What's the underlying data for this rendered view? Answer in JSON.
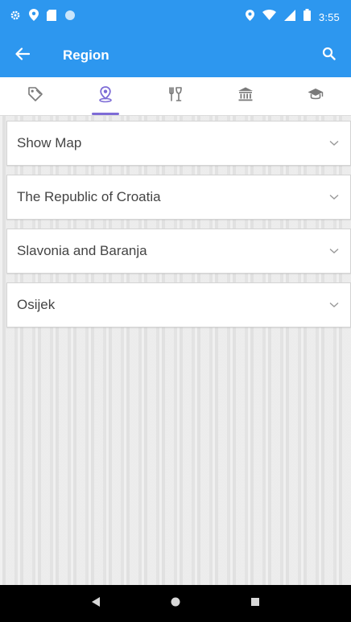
{
  "status_bar": {
    "time": "3:55"
  },
  "app_bar": {
    "title": "Region"
  },
  "tabs": [
    {
      "icon": "tag-icon",
      "active": false
    },
    {
      "icon": "location-pin-icon",
      "active": true
    },
    {
      "icon": "restaurant-icon",
      "active": false
    },
    {
      "icon": "museum-icon",
      "active": false
    },
    {
      "icon": "graduation-cap-icon",
      "active": false
    }
  ],
  "rows": [
    {
      "label": "Show Map"
    },
    {
      "label": "The Republic of Croatia"
    },
    {
      "label": "Slavonia and Baranja"
    },
    {
      "label": "Osijek"
    }
  ],
  "colors": {
    "app_bar": "#2d97ef",
    "active_tab": "#7d6bd6"
  }
}
